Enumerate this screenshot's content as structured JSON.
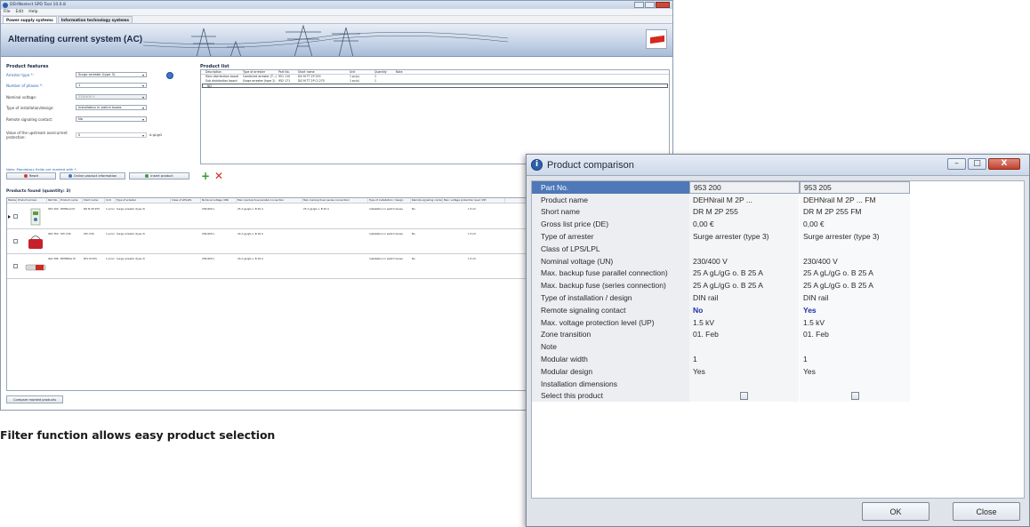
{
  "main_window": {
    "title": "DEHNselect SPD Tool 10.0.8",
    "menu": [
      "File",
      "Edit",
      "Help"
    ],
    "tabs": [
      "Power supply systems",
      "Information technology systems"
    ],
    "system_title": "Alternating current system (AC)",
    "product_features": {
      "title": "Product features",
      "fields": [
        {
          "label": "Arrester type *:",
          "value": "Surge arrester (type 3)",
          "required": true
        },
        {
          "label": "Number of phases *:",
          "value": "1",
          "required": true
        },
        {
          "label": "Nominal voltage:",
          "value": "230/400 V",
          "required": false,
          "disabled": true
        },
        {
          "label": "Type of installation/design:",
          "value": "Installation in switch boxes",
          "required": false
        },
        {
          "label": "Remote signaling contact:",
          "value": "No",
          "required": false
        },
        {
          "label": "Value of the upstream overcurrent protection:",
          "value": "0",
          "unit": "A gL/gG",
          "required": false
        }
      ],
      "required_note": "Note: Mandatory fields are marked with *."
    },
    "product_list": {
      "title": "Product list",
      "columns": [
        "Description",
        "Type of arrester",
        "Part No.",
        "Short name",
        "Unit",
        "Quantity",
        "Note"
      ],
      "rows": [
        [
          "Main distribution board",
          "Combined arrester (T...)",
          "951 110",
          "DG M TT 2P 255",
          "1 pc(s)",
          "1",
          ""
        ],
        [
          "Sub distribution board",
          "Surge arrester (type 2)",
          "952 171",
          "DG M TT 2P CI 275",
          "1 pc(s)",
          "1",
          ""
        ]
      ],
      "input_row": "ND"
    },
    "buttons": {
      "reset": "Reset",
      "online_info": "Online product information",
      "insert_product": "Insert product",
      "compare": "Compare marked products"
    },
    "products_found": {
      "title": "Products found (quantity: 3)",
      "columns": [
        "Marked",
        "Product picture",
        "Part No.",
        "Product name",
        "Short name",
        "Unit",
        "Type of arrester",
        "Class of LPS/LPL",
        "Nominal voltage (UN)",
        "Max. backup fuse parallel connection",
        "Max. backup fuse (series connection)",
        "Type of installation / design",
        "Remote signaling contact",
        "Max. voltage protection level (UP)"
      ],
      "rows": [
        {
          "part": "953 200",
          "name": "DEHNrail M",
          "short": "DR M 2P 255",
          "unit": "1 pc(s)",
          "type": "Surge arrester (type 3)",
          "voltage": "230/400 V",
          "fuse_par": "25 A gL/gG o. B 25 A",
          "fuse_ser": "25 A gL/gG o. B 25 A",
          "install": "Installation in switch boxes",
          "remote": "No",
          "up": "1.5 kV"
        },
        {
          "part": "924 350",
          "name": "STC 230",
          "short": "STC 230",
          "unit": "1 pc(s)",
          "type": "Surge arrester (type 3)",
          "voltage": "230/400 V",
          "fuse_par": "16 A gL/gG o. B 16 A",
          "fuse_ser": "",
          "install": "Installation in switch boxes",
          "remote": "No",
          "up": "1.3 kV"
        },
        {
          "part": "924 396",
          "name": "DEHNflex M",
          "short": "DFL M 255",
          "unit": "1 pc(s)",
          "type": "Surge arrester (type 3)",
          "voltage": "230/400 V",
          "fuse_par": "16 A gL/gG o. B 16 A",
          "fuse_ser": "",
          "install": "Installation in switch boxes",
          "remote": "No",
          "up": "1.5 kV"
        }
      ]
    }
  },
  "caption": "Filter function allows easy product selection",
  "dialog": {
    "title": "Product comparison",
    "rows": [
      {
        "label": "Part No.",
        "v1": "953 200",
        "v2": "953 205"
      },
      {
        "label": "Product name",
        "v1": "DEHNrail M 2P ...",
        "v2": "DEHNrail M 2P ... FM"
      },
      {
        "label": "Short name",
        "v1": "DR M 2P 255",
        "v2": "DR M 2P 255 FM"
      },
      {
        "label": "Gross list price (DE)",
        "v1": "0,00 €",
        "v2": "0,00 €"
      },
      {
        "label": "Type of arrester",
        "v1": "Surge arrester (type 3)",
        "v2": "Surge arrester (type 3)"
      },
      {
        "label": "Class of LPS/LPL",
        "v1": "",
        "v2": ""
      },
      {
        "label": "Nominal voltage (UN)",
        "v1": "230/400 V",
        "v2": "230/400 V"
      },
      {
        "label": "Max. backup fuse parallel connection)",
        "v1": "25 A gL/gG o. B 25 A",
        "v2": "25 A gL/gG o. B 25 A"
      },
      {
        "label": "Max. backup fuse (series connection)",
        "v1": "25 A gL/gG o. B 25 A",
        "v2": "25 A gL/gG o. B 25 A"
      },
      {
        "label": "Type of installation / design",
        "v1": "DIN rail",
        "v2": "DIN rail"
      },
      {
        "label": "Remote signaling contact",
        "v1": "No",
        "v2": "Yes"
      },
      {
        "label": "Max. voltage protection level (UP)",
        "v1": "1.5 kV",
        "v2": "1.5 kV"
      },
      {
        "label": "Zone transition",
        "v1": "01. Feb",
        "v2": "01. Feb"
      },
      {
        "label": "Note",
        "v1": "",
        "v2": ""
      },
      {
        "label": "Modular width",
        "v1": "1",
        "v2": "1"
      },
      {
        "label": "Modular design",
        "v1": "Yes",
        "v2": "Yes"
      },
      {
        "label": "Installation dimensions",
        "v1": "",
        "v2": ""
      },
      {
        "label": "Select this product",
        "v1": "",
        "v2": ""
      }
    ],
    "ok_label": "OK",
    "close_label": "Close",
    "close_glyph": "X"
  }
}
